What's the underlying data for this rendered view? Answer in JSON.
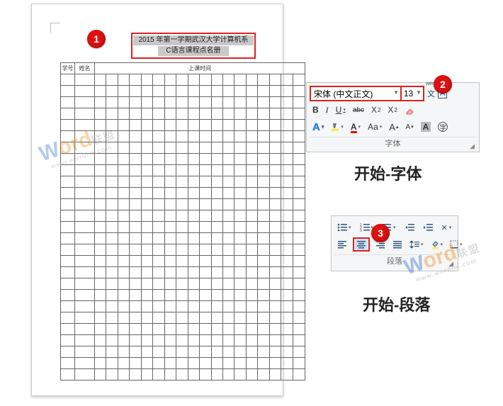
{
  "badges": {
    "b1": "1",
    "b2": "2",
    "b3": "3"
  },
  "document": {
    "title_line1": "2015 年第一学期武汉大学计算机系",
    "title_line2": "C语言课程点名册",
    "headers": {
      "col1": "学号",
      "col2": "姓名",
      "col3": "上课时间"
    }
  },
  "font_panel": {
    "font_name": "宋体 (中文正文)",
    "font_size": "13",
    "buttons": {
      "bold": "B",
      "italic": "I",
      "underline": "U",
      "strike": "abc",
      "sub": "X",
      "sub_s": "2",
      "sup": "X",
      "sup_s": "2"
    },
    "row3_A_outline": "A",
    "row3_Aa": "Aa",
    "row3_grow": "A",
    "row3_shrink": "A",
    "row3_Abox": "A",
    "row3_zi": "字",
    "group_label": "字体"
  },
  "section_titles": {
    "font": "开始-字体",
    "para": "开始-段落"
  },
  "para_panel": {
    "group_label": "段落"
  },
  "watermark": {
    "pre": "W",
    "mid": "ord",
    "suf": "联盟",
    "sub": "www.wordlm.com"
  }
}
